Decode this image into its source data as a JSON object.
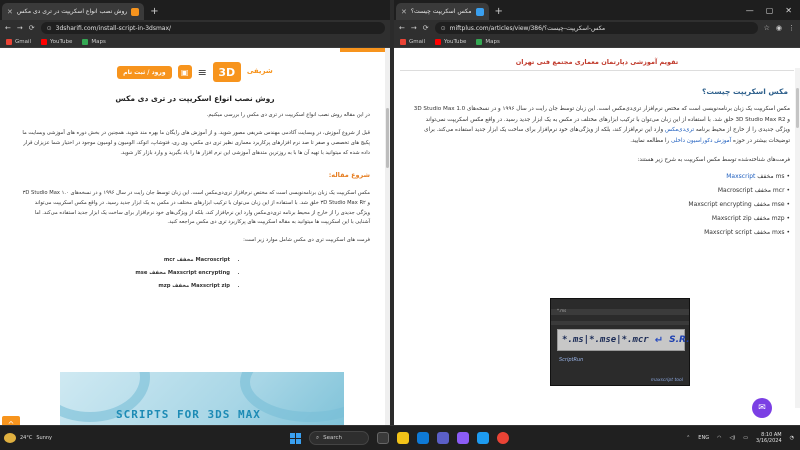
{
  "left_window": {
    "tab_title": "روش نصب انواع اسکریپت در تری دی مکس",
    "favicon_text": "3",
    "url": "3dsharifi.com/install-script-in-3dsmax/",
    "bookmarks": [
      "Gmail",
      "YouTube",
      "Maps"
    ],
    "login_button": "ورود / ثبت نام",
    "logo_text": "3D",
    "logo_sub": "شریفی",
    "page_title": "روش نصب انواع اسکریپت در تری دی مکس",
    "intro": "در این مقاله روش نصب انواع اسکریپت در تری دی مکس را بررسی میکنیم.",
    "para1": "قبل از شروع آموزش، در وبسایت آکادمی مهندس شریفی مصور شوید. و از آموزش های رایگان ما بهره مند شوید. همچنین در بخش دوره های آموزشی وبسایت ما پکیج های تخصصی و صفر تا صد نرم افزارهای پرکاربرد معماری نظیر تری دی مکس، وی ری، فتوشاپ، اتوکد، الومیون و لومیون موجود در اختیار شما عزیزان قرار داده شده که میتوانید با تهیه آن ها با به روزترین متدهای آموزشی این نرم افزار ها را یاد بگیرید و وارد بازار کار شوید.",
    "heading": "شروع مقاله:",
    "para2": "مکس اسکریپت یک زبان برنامه‌نویسی است که مختص نرم‌افزار تری‌دی‌مکس است. این زبان توسط جان رایت در سال ۱۹۹۶ و در نسخه‌های ۳D Studio Max ۱.۰ و ۳D Studio Max R۲ خلق شد. با استفاده از این زبان می‌توان با ترکیب ابزارهای مختلف در مکس به یک ابزار جدید رسید. در واقع مکس اسکریپت می‌تواند ویژگی جدیدی را از خارج از محیط برنامه تری‌دی‌مکس وارد این نرم‌افزار کند، بلکه از ویژگی‌های خود نرم‌افزار برای ساخت یک ابزار جدید استفاده می‌کند. اما آشنایی با این اسکریپت ها میتوانید به مقاله اسکریپت های پرکاربرد تری دی مکس مراجعه کنید.",
    "para3": "فرمت های اسکریپت تری دی مکس شامل موارد زیر است:",
    "formats": [
      "Macroscript مخفف mcr",
      "Maxscript encrypting مخفف mse",
      "Maxscript zip مخفف mzp"
    ],
    "banner_text_a": "SCRIPTS FOR ",
    "banner_text_b": "3DS MAX",
    "up_arrow": "^"
  },
  "right_window": {
    "tab_title": "مکس اسکریپت چیست؟",
    "url": "miftplus.com/articles/view/386/مکس-اسکریپت-چیست؟",
    "bookmarks": [
      "Gmail",
      "YouTube",
      "Maps"
    ],
    "top_banner": "تقویم آموزشی دپارتمان معماری مجتمع فنی تهران",
    "heading": "مکس اسکریپت چیست؟",
    "para1": "مکس اسکریپت یک زبان برنامه‌نویسی است که مختص نرم‌افزار تری‌دی‌مکس است. این زبان توسط جان رایت در سال ۱۹۹۶ و در نسخه‌های 3D Studio Max 1.0 و 3D Studio Max R2 خلق شد. با استفاده از این زبان می‌توان با ترکیب ابزارهای مختلف در مکس به یک ابزار جدید رسید. در واقع مکس اسکریپت نمی‌تواند ویژگی جدیدی را از خارج از محیط برنامه",
    "para1_link": "تری‌دی‌مکس",
    "para1_tail": "وارد این نرم‌افزار کند، بلکه از ویژگی‌های خود نرم‌افزار برای ساخت یک ابزار جدید استفاده می‌کند. برای توضیحات بیشتر در حوزه",
    "para1_link2": "آموزش دکوراسیون داخلی",
    "para1_end": "را مطالعه نمایید.",
    "para2": "فرمت‌های شناخته‌شده توسط مکس اسکریپت به شرح زیر هستند:",
    "formats": [
      {
        "name": "Maxscript",
        "ext": "ms",
        "label": "مخفف"
      },
      {
        "name": "Macroscript",
        "ext": "mcr",
        "label": "مخفف"
      },
      {
        "name": "Maxscript encrypting",
        "ext": "mse",
        "label": "مخفف"
      },
      {
        "name": "Maxscript zip",
        "ext": "mzp",
        "label": "مخفف"
      },
      {
        "name": "Maxscript script",
        "ext": "mxs",
        "label": "مخفف"
      }
    ],
    "img_bar_label": "*.ms",
    "img_ext": "*.ms|*.mse|*.mcr",
    "img_arrow": "↵",
    "img_logo": "S.R.",
    "img_run": "ScriptRun",
    "img_foot": "maxscript tool",
    "chat_icon": "chat-icon"
  },
  "taskbar": {
    "weather_temp": "24°C",
    "weather_desc": "Sunny",
    "search_placeholder": "Search",
    "lang": "ENG",
    "time": "8:10 AM",
    "date": "3/16/2024"
  },
  "colors": {
    "accent_orange": "#f7941d",
    "link_blue": "#1f5fbf",
    "heading_blue": "#2d5f8b",
    "banner_red": "#c0392b"
  }
}
